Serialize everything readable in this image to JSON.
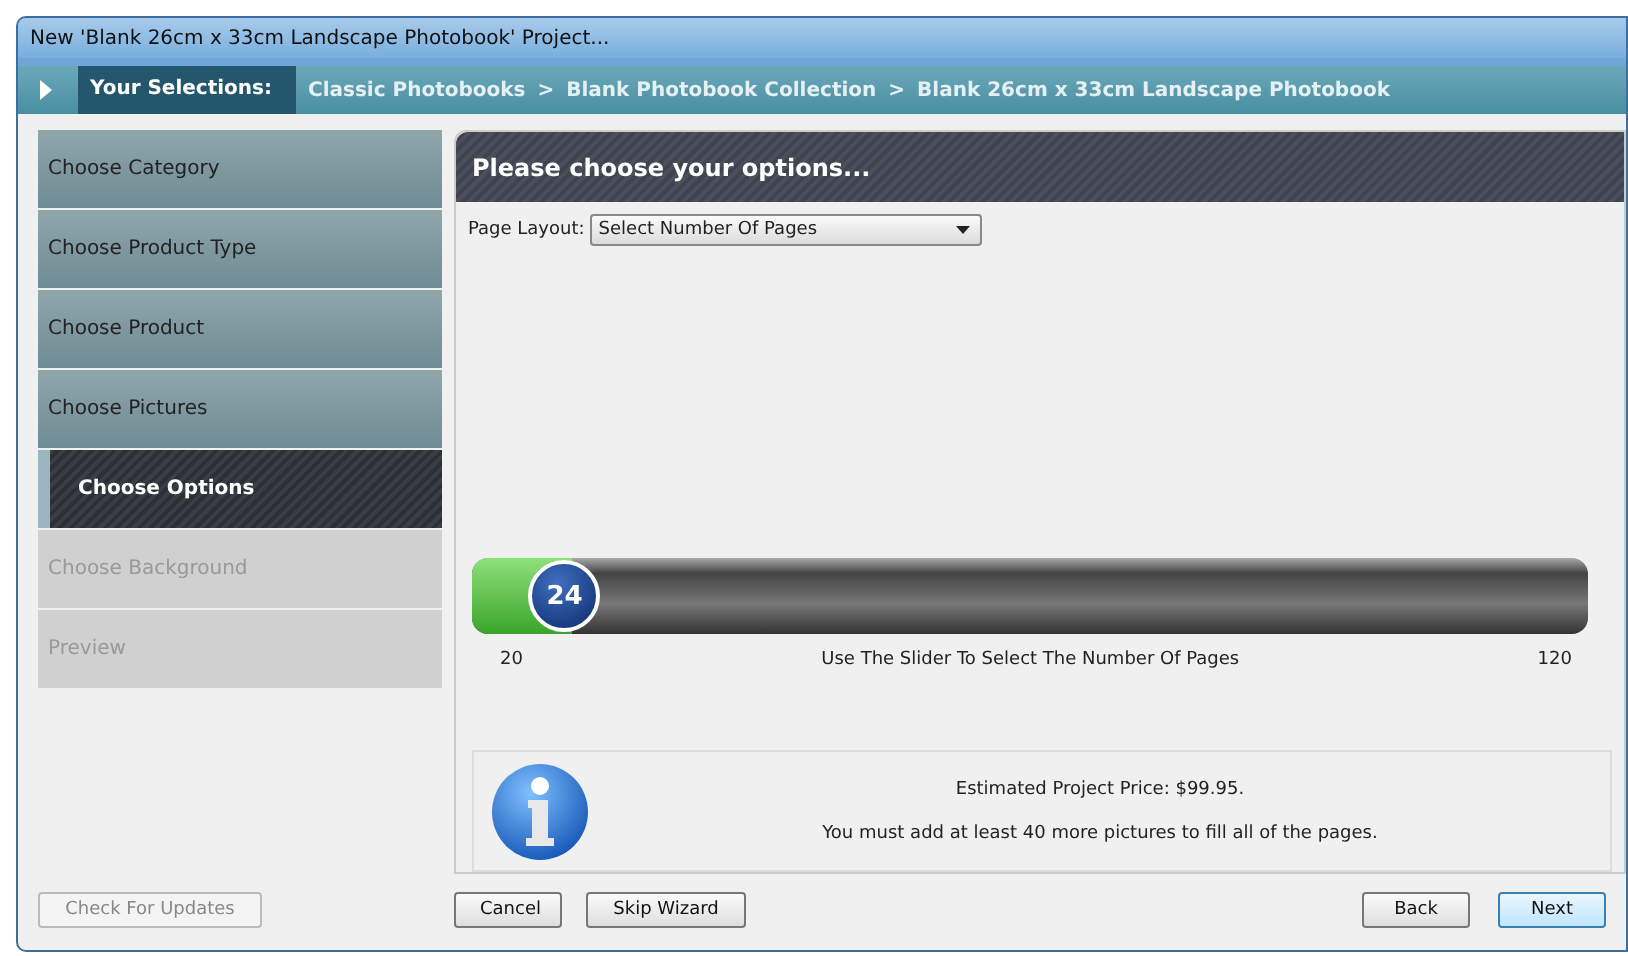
{
  "window": {
    "title": "New 'Blank 26cm x 33cm Landscape Photobook' Project..."
  },
  "breadcrumb": {
    "label": "Your Selections:",
    "items": [
      "Classic Photobooks",
      "Blank Photobook Collection",
      "Blank 26cm x 33cm Landscape Photobook"
    ],
    "separator": ">"
  },
  "steps": [
    {
      "label": "Choose Category",
      "selected": false,
      "disabled": false
    },
    {
      "label": "Choose Product Type",
      "selected": false,
      "disabled": false
    },
    {
      "label": "Choose Product",
      "selected": false,
      "disabled": false
    },
    {
      "label": "Choose Pictures",
      "selected": false,
      "disabled": false
    },
    {
      "label": "Choose Options",
      "selected": true,
      "disabled": false
    },
    {
      "label": "Choose Background",
      "selected": false,
      "disabled": true
    },
    {
      "label": "Preview",
      "selected": false,
      "disabled": true
    }
  ],
  "panel": {
    "title": "Please choose your options...",
    "page_layout": {
      "label": "Page Layout:",
      "value": "Select Number Of Pages"
    },
    "slider": {
      "value": "24",
      "level": 0.04,
      "min": "20",
      "max": "120",
      "hint": "Use The Slider To Select The Number Of Pages"
    },
    "info": {
      "price": "Estimated Project Price: $99.95.",
      "message": "You must add at least 40 more pictures to fill all of the pages."
    }
  },
  "footer": {
    "update_button": {
      "label": "Check For Updates",
      "disabled": true
    },
    "left_buttons": [
      "Cancel",
      "Skip Wizard"
    ],
    "right_buttons": [
      {
        "label": "Back",
        "default": false
      },
      {
        "label": "Next",
        "default": true
      }
    ]
  }
}
